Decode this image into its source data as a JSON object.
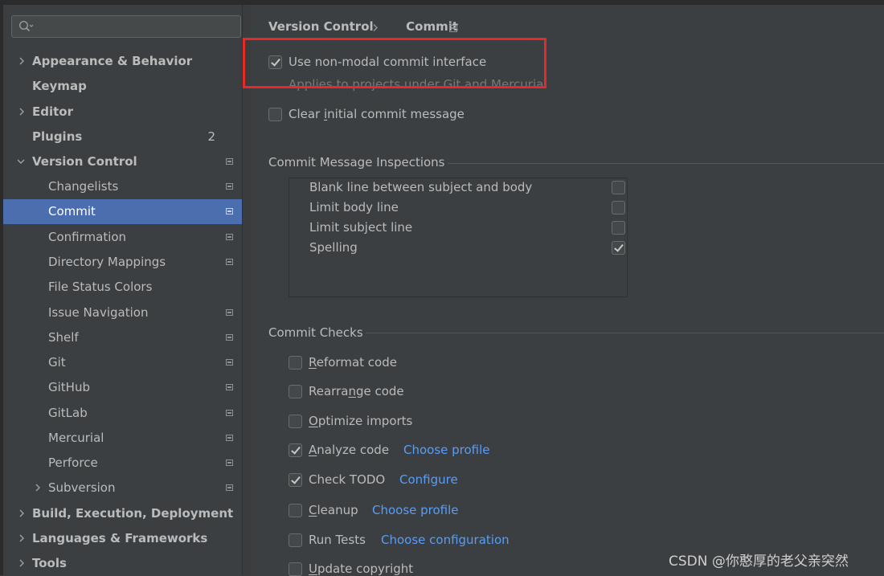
{
  "sidebar": {
    "search": {
      "placeholder": "",
      "value": ""
    },
    "items": [
      {
        "label": "Appearance & Behavior",
        "level": 0,
        "expandable": true,
        "expanded": false
      },
      {
        "label": "Keymap",
        "level": 0
      },
      {
        "label": "Editor",
        "level": 0,
        "expandable": true,
        "expanded": false
      },
      {
        "label": "Plugins",
        "level": 0,
        "badge": "2"
      },
      {
        "label": "Version Control",
        "level": 0,
        "expandable": true,
        "expanded": true,
        "project_icon": true
      },
      {
        "label": "Changelists",
        "level": 1,
        "project_icon": true
      },
      {
        "label": "Commit",
        "level": 1,
        "project_icon": true,
        "selected": true
      },
      {
        "label": "Confirmation",
        "level": 1,
        "project_icon": true
      },
      {
        "label": "Directory Mappings",
        "level": 1,
        "project_icon": true
      },
      {
        "label": "File Status Colors",
        "level": 1
      },
      {
        "label": "Issue Navigation",
        "level": 1,
        "project_icon": true
      },
      {
        "label": "Shelf",
        "level": 1,
        "project_icon": true
      },
      {
        "label": "Git",
        "level": 1,
        "project_icon": true
      },
      {
        "label": "GitHub",
        "level": 1,
        "project_icon": true
      },
      {
        "label": "GitLab",
        "level": 1,
        "project_icon": true
      },
      {
        "label": "Mercurial",
        "level": 1,
        "project_icon": true
      },
      {
        "label": "Perforce",
        "level": 1,
        "project_icon": true
      },
      {
        "label": "Subversion",
        "level": 1,
        "expandable": true,
        "expanded": false,
        "project_icon": true
      },
      {
        "label": "Build, Execution, Deployment",
        "level": 0,
        "expandable": true,
        "expanded": false
      },
      {
        "label": "Languages & Frameworks",
        "level": 0,
        "expandable": true,
        "expanded": false
      },
      {
        "label": "Tools",
        "level": 0,
        "expandable": true,
        "expanded": false
      }
    ]
  },
  "breadcrumb": {
    "parent": "Version Control",
    "current": "Commit"
  },
  "options": {
    "non_modal": {
      "label": "Use non-modal commit interface",
      "checked": true,
      "hint": "Applies to projects under Git and Mercurial"
    },
    "clear_initial": {
      "label_pre": "Clear ",
      "mnemonic": "i",
      "label_post": "nitial commit message",
      "checked": false
    }
  },
  "inspections": {
    "title": "Commit Message Inspections",
    "items": [
      {
        "label": "Blank line between subject and body",
        "checked": false
      },
      {
        "label": "Limit body line",
        "checked": false
      },
      {
        "label": "Limit subject line",
        "checked": false
      },
      {
        "label": "Spelling",
        "checked": true
      }
    ]
  },
  "checks": {
    "title": "Commit Checks",
    "items": [
      {
        "mnemonic": "R",
        "rest": "eformat code",
        "checked": false
      },
      {
        "pre": "Rearra",
        "mnemonic": "n",
        "rest": "ge code",
        "checked": false
      },
      {
        "mnemonic": "O",
        "rest": "ptimize imports",
        "checked": false
      },
      {
        "mnemonic": "A",
        "rest": "nalyze code",
        "checked": true,
        "link": "Choose profile"
      },
      {
        "pre": "Check TODO",
        "checked": true,
        "link": "Configure"
      },
      {
        "mnemonic": "C",
        "rest": "leanup",
        "checked": false,
        "link": "Choose profile"
      },
      {
        "pre": "Run Tests",
        "checked": false,
        "link": "Choose configuration"
      },
      {
        "mnemonic": "U",
        "rest": "pdate copyright",
        "checked": false
      }
    ]
  },
  "watermark": "CSDN @你憨厚的老父亲突然",
  "colors": {
    "background": "#3c3f41",
    "selection": "#4b6eaf",
    "link": "#589df6",
    "highlight_box": "#e62a2a"
  }
}
